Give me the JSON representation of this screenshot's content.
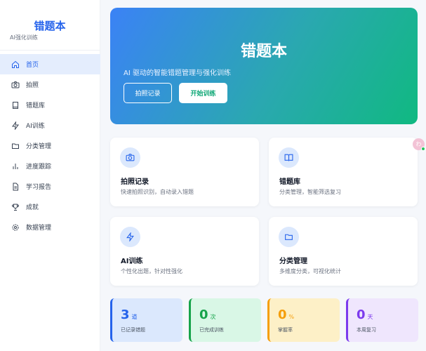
{
  "sidebar": {
    "title": "错题本",
    "subtitle": "AI强化训练",
    "items": [
      {
        "label": "首页",
        "icon": "home-icon"
      },
      {
        "label": "拍照",
        "icon": "camera-icon"
      },
      {
        "label": "错题库",
        "icon": "book-icon"
      },
      {
        "label": "AI训练",
        "icon": "bolt-icon"
      },
      {
        "label": "分类管理",
        "icon": "folder-icon"
      },
      {
        "label": "进度跟踪",
        "icon": "bar-chart-icon"
      },
      {
        "label": "学习报告",
        "icon": "document-icon"
      },
      {
        "label": "成就",
        "icon": "trophy-icon"
      },
      {
        "label": "数据管理",
        "icon": "gear-icon"
      }
    ]
  },
  "hero": {
    "title": "错题本",
    "subtitle": "AI 驱动的智能错题管理与强化训练",
    "btn_photo": "拍照记录",
    "btn_train": "开始训练"
  },
  "cards": [
    {
      "title": "拍照记录",
      "desc": "快速拍照识别，自动录入错题",
      "icon": "camera-icon"
    },
    {
      "title": "错题库",
      "desc": "分类管理，智能筛选复习",
      "icon": "book-icon"
    },
    {
      "title": "AI训练",
      "desc": "个性化出题，针对性强化",
      "icon": "bolt-icon"
    },
    {
      "title": "分类管理",
      "desc": "多维度分类，可视化统计",
      "icon": "folder-icon"
    }
  ],
  "stats": [
    {
      "value": "3",
      "unit": "道",
      "label": "已记录错题",
      "color": "#2563eb",
      "bg": "#dbe8fd"
    },
    {
      "value": "0",
      "unit": "次",
      "label": "已完成训练",
      "color": "#16a34a",
      "bg": "#d9f7e6"
    },
    {
      "value": "0",
      "unit": "%",
      "label": "掌握率",
      "color": "#f59e0b",
      "bg": "#fdf0c7"
    },
    {
      "value": "0",
      "unit": "天",
      "label": "本周复习",
      "color": "#7c3aed",
      "bg": "#efe6fd"
    }
  ],
  "avatar": {
    "text": "わ"
  },
  "colors": {
    "accent": "#2563eb",
    "active_bg": "#e4edfd",
    "green": "#10b981"
  }
}
